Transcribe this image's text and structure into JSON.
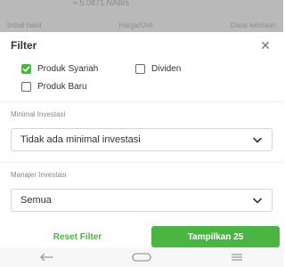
{
  "background": {
    "top_text": "≈ 5.0871 NAB/s",
    "columns": [
      "Imbal hasil",
      "Harga/Unit",
      "Dana kelolaan"
    ]
  },
  "filter": {
    "title": "Filter",
    "close_icon": "close-icon"
  },
  "options": {
    "produk_syariah": {
      "label": "Produk Syariah",
      "checked": true
    },
    "dividen": {
      "label": "Dividen",
      "checked": false
    },
    "produk_baru": {
      "label": "Produk Baru",
      "checked": false
    }
  },
  "minimal_investasi": {
    "label": "Minimal Investasi",
    "value": "Tidak ada minimal investasi"
  },
  "manajer_investasi": {
    "label": "Manajer Investasi",
    "value": "Semua"
  },
  "buttons": {
    "reset": "Reset Filter",
    "apply": "Tampilkan 25"
  },
  "colors": {
    "accent": "#4bb543"
  },
  "navbar": {
    "back_icon": "back-arrow-icon",
    "home_icon": "home-pill-icon",
    "menu_icon": "menu-icon"
  }
}
